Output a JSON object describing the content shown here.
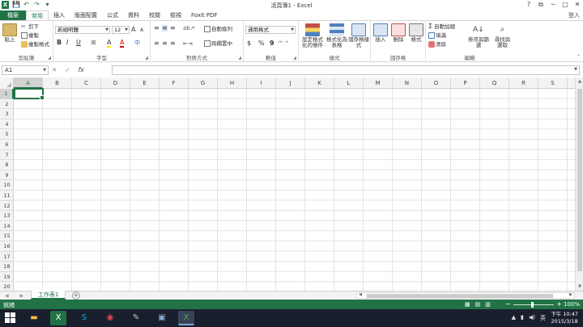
{
  "window": {
    "title": "活頁簿1 - Excel",
    "login_label": "登入",
    "controls": [
      "?",
      "⧉",
      "─",
      "□",
      "✕"
    ]
  },
  "qat": {
    "logo": "X",
    "save": "💾",
    "undo": "↶",
    "redo": "↷",
    "more": "▾"
  },
  "tabs": [
    {
      "label": "檔案"
    },
    {
      "label": "常用"
    },
    {
      "label": "插入"
    },
    {
      "label": "版面配置"
    },
    {
      "label": "公式"
    },
    {
      "label": "資料"
    },
    {
      "label": "校閱"
    },
    {
      "label": "檢視"
    },
    {
      "label": "Foxit PDF"
    }
  ],
  "ribbon": {
    "clipboard": {
      "label": "剪貼簿",
      "paste": "貼上",
      "cut": "剪下",
      "copy": "複製",
      "format_painter": "複製格式"
    },
    "font": {
      "label": "字型",
      "font_name": "新細明體",
      "font_size": "12",
      "bold": "B",
      "italic": "I",
      "underline": "U",
      "grow": "A",
      "shrink": "A",
      "border": "⊞",
      "fill": "A",
      "color": "A",
      "phonetic": "中"
    },
    "alignment": {
      "label": "對齊方式",
      "wrap": "自動換列",
      "merge": "跨欄置中"
    },
    "number": {
      "label": "數值",
      "format": "通用格式",
      "currency": "$",
      "percent": "%",
      "comma": "9"
    },
    "styles": {
      "label": "樣式",
      "conditional": "設定格式化的條件",
      "table": "格式化為表格",
      "cell": "儲存格樣式"
    },
    "cells": {
      "label": "儲存格",
      "insert": "插入",
      "delete": "刪除",
      "format": "格式"
    },
    "editing": {
      "label": "編輯",
      "autosum": "自動加總",
      "fill": "填滿",
      "clear": "清除",
      "sort": "排序與篩選",
      "find": "尋找與選取"
    }
  },
  "formula_bar": {
    "name_box": "A1",
    "cancel": "✕",
    "enter": "✓",
    "fx": "fx",
    "value": ""
  },
  "grid": {
    "columns": [
      "A",
      "B",
      "C",
      "D",
      "E",
      "F",
      "G",
      "H",
      "I",
      "J",
      "K",
      "L",
      "M",
      "N",
      "O",
      "P",
      "Q",
      "R",
      "S"
    ],
    "rows": [
      "1",
      "2",
      "3",
      "4",
      "5",
      "6",
      "7",
      "8",
      "9",
      "10",
      "11",
      "12",
      "13",
      "14",
      "15",
      "16",
      "17",
      "18",
      "19",
      "20"
    ],
    "active_cell": "A1"
  },
  "sheets": {
    "tabs": [
      {
        "label": "工作表1"
      }
    ],
    "add": "+",
    "nav": "◀ ▶"
  },
  "status": {
    "text": "就緒",
    "zoom": "100%"
  },
  "taskbar": {
    "clock_time": "下午 10:47",
    "clock_date": "2015/3/18",
    "ime": "英",
    "apps": [
      "folder-icon",
      "excel-icon",
      "skype-icon",
      "chrome-icon",
      "tool-icon",
      "explorer-icon",
      "excel-icon"
    ]
  }
}
